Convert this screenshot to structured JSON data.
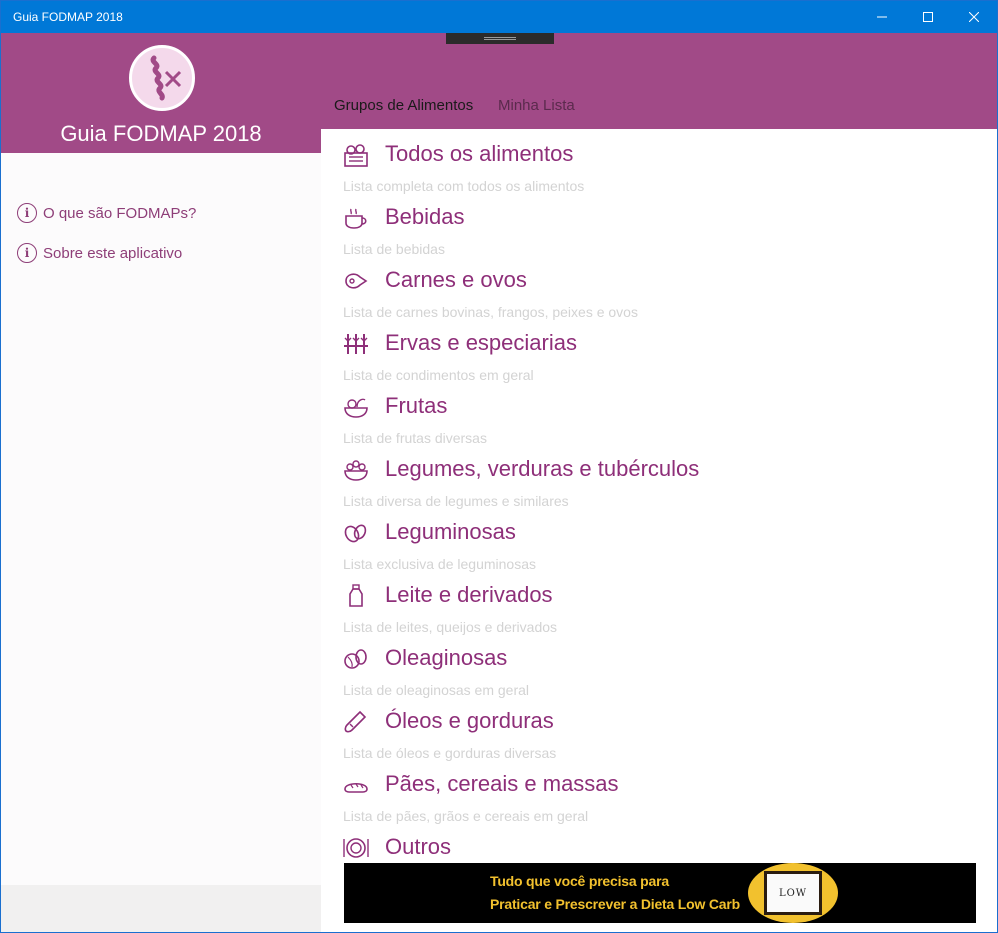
{
  "window": {
    "title": "Guia FODMAP 2018",
    "controls": {
      "minimize": "─",
      "maximize": "☐",
      "close": "✕"
    }
  },
  "colors": {
    "titlebar": "#0078d7",
    "brand": "#a14a87",
    "category_title": "#8e2f79",
    "description": "#d3d3d3",
    "ad_text": "#f2c12e"
  },
  "sidebar": {
    "app_title": "Guia FODMAP 2018",
    "logo_icon": "gut-fork-knife-icon",
    "links": [
      {
        "label": "O que são FODMAPs?",
        "icon": "info-icon",
        "glyph": "i"
      },
      {
        "label": "Sobre este aplicativo",
        "icon": "info-icon",
        "glyph": "i"
      }
    ]
  },
  "tabs": [
    {
      "label": "Grupos de Alimentos",
      "selected": true
    },
    {
      "label": "Minha Lista",
      "selected": false
    }
  ],
  "categories": [
    {
      "title": "Todos os alimentos",
      "description": "Lista completa com todos os alimentos",
      "icon": "grocery-box-icon"
    },
    {
      "title": "Bebidas",
      "description": "Lista de bebidas",
      "icon": "coffee-cup-icon"
    },
    {
      "title": "Carnes e ovos",
      "description": "Lista de carnes bovinas, frangos, peixes e ovos",
      "icon": "ham-icon"
    },
    {
      "title": "Ervas e especiarias",
      "description": "Lista de condimentos em geral",
      "icon": "herbs-icon"
    },
    {
      "title": "Frutas",
      "description": "Lista de frutas diversas",
      "icon": "fruit-bowl-icon"
    },
    {
      "title": "Legumes, verduras e tubérculos",
      "description": "Lista diversa de legumes e similares",
      "icon": "vegetable-bowl-icon"
    },
    {
      "title": "Leguminosas",
      "description": "Lista exclusiva de leguminosas",
      "icon": "beans-icon"
    },
    {
      "title": "Leite e derivados",
      "description": "Lista de leites, queijos e derivados",
      "icon": "milk-bottle-icon"
    },
    {
      "title": "Oleaginosas",
      "description": "Lista de oleaginosas em geral",
      "icon": "nuts-icon"
    },
    {
      "title": "Óleos e gorduras",
      "description": "Lista de óleos e gorduras diversas",
      "icon": "oil-bottle-icon"
    },
    {
      "title": "Pães, cereais e massas",
      "description": "Lista de pães, grãos e cereais em geral",
      "icon": "bread-icon"
    },
    {
      "title": "Outros",
      "description": "",
      "icon": "other-food-icon"
    }
  ],
  "ad": {
    "line1": "Tudo que você precisa para",
    "line2": "Praticar e Prescrever a Dieta Low Carb",
    "badge_text": "LOW"
  }
}
